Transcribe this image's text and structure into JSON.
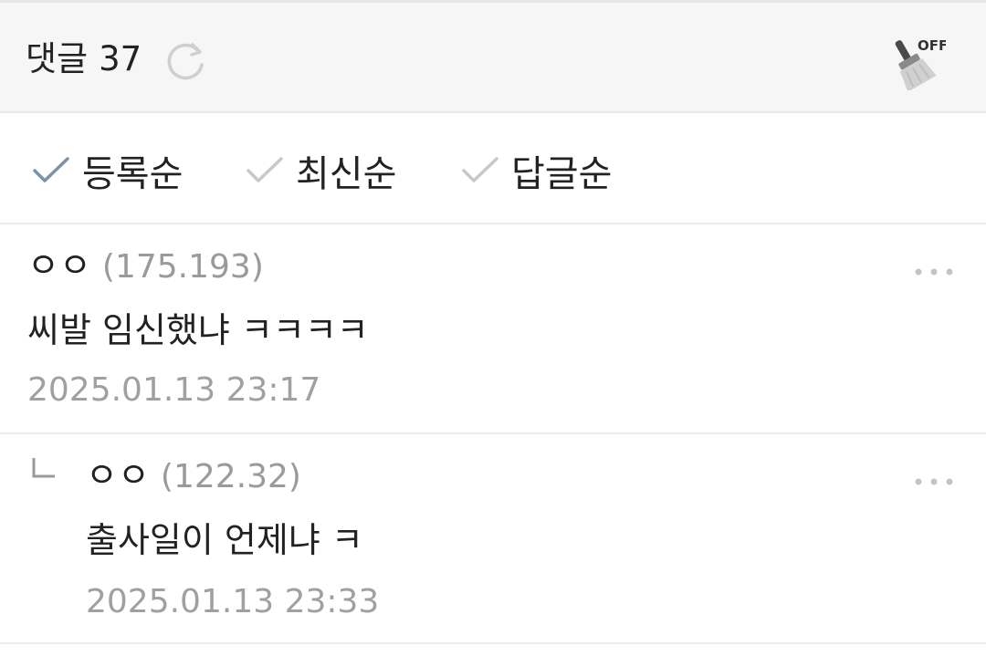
{
  "header": {
    "title": "댓글",
    "count": "37",
    "refresh_icon": "refresh-icon",
    "clean_toggle_icon": "broom-off-icon",
    "clean_toggle_label": "OFF"
  },
  "sort": {
    "options": [
      {
        "label": "등록순",
        "selected": true
      },
      {
        "label": "최신순",
        "selected": false
      },
      {
        "label": "답글순",
        "selected": false
      }
    ],
    "selected_color": "#7a93a8",
    "unselected_color": "#c8c8c8"
  },
  "comments": [
    {
      "name": "ㅇㅇ",
      "ip": "(175.193)",
      "text": "씨발 임신했냐 ㅋㅋㅋㅋ",
      "date": "2025.01.13 23:17",
      "is_reply": false
    },
    {
      "name": "ㅇㅇ",
      "ip": "(122.32)",
      "text": "출사일이 언제냐 ㅋ",
      "date": "2025.01.13 23:33",
      "is_reply": true
    }
  ]
}
